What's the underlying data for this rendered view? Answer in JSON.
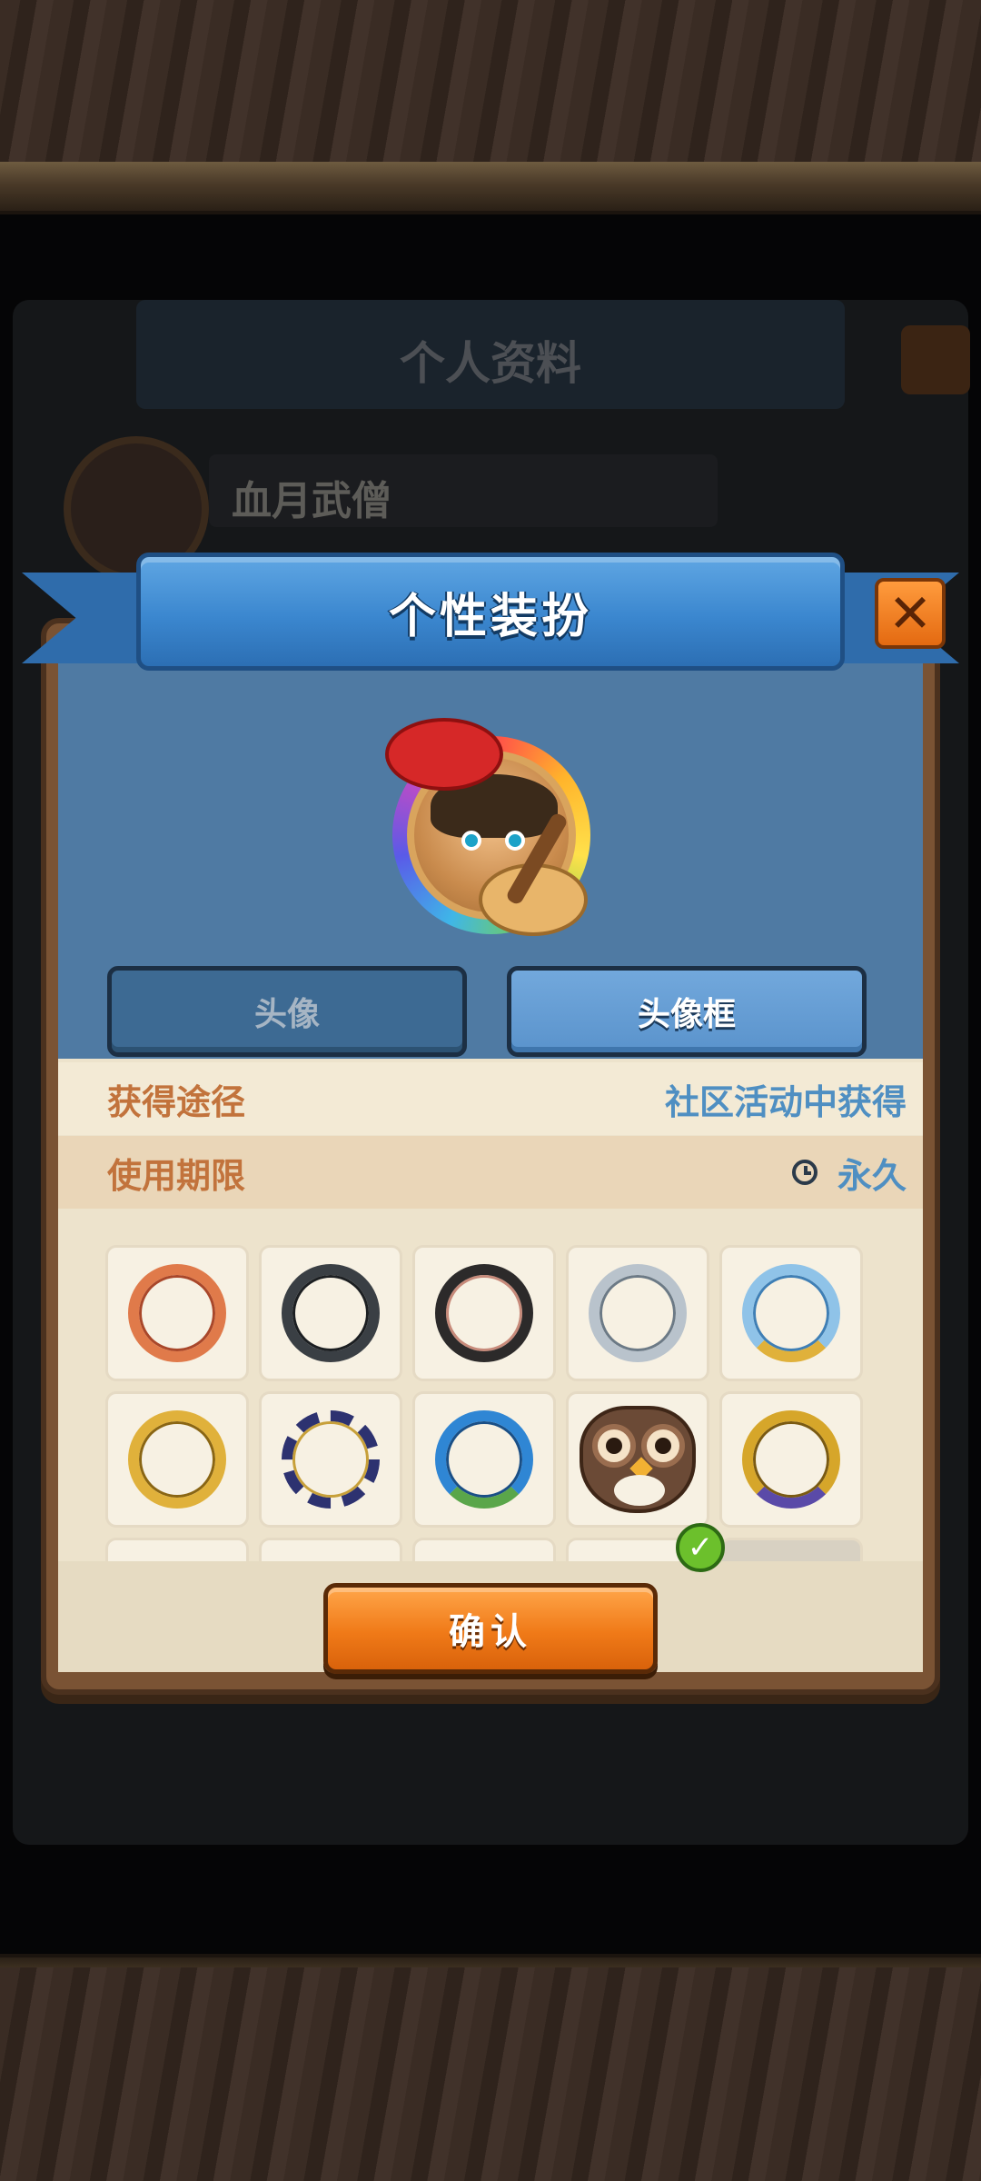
{
  "background": {
    "window_title": "个人资料",
    "player_name": "血月武僧"
  },
  "dialog": {
    "title": "个性装扮",
    "close_icon": "close-x-icon"
  },
  "tabs": [
    {
      "label": "头像",
      "selected": false
    },
    {
      "label": "头像框",
      "selected": true
    }
  ],
  "info": {
    "source_label": "获得途径",
    "source_value": "社区活动中获得",
    "period_label": "使用期限",
    "period_value": "永久",
    "period_icon": "clock-icon"
  },
  "frames": [
    {
      "name": "copper-ring-frame",
      "color": "#e07a4a"
    },
    {
      "name": "dark-steel-ring-frame",
      "color": "#3a3f44"
    },
    {
      "name": "black-rose-ring-frame",
      "color": "#2c2a2a"
    },
    {
      "name": "silver-ring-frame",
      "color": "#b9c3cc"
    },
    {
      "name": "gold-blue-ring-frame",
      "color": "#8fc3e8"
    },
    {
      "name": "gold-winged-ring-frame",
      "color": "#e0b13b"
    },
    {
      "name": "chain-ring-frame",
      "color": "#2d3270"
    },
    {
      "name": "wave-ring-frame",
      "color": "#2f86d4"
    },
    {
      "name": "owl-frame",
      "color": "#6b4a36",
      "equipped": true
    },
    {
      "name": "gold-purple-ring-frame",
      "color": "#d6a62a"
    }
  ],
  "equipped_icon": "check-icon",
  "confirm_label": "确认"
}
